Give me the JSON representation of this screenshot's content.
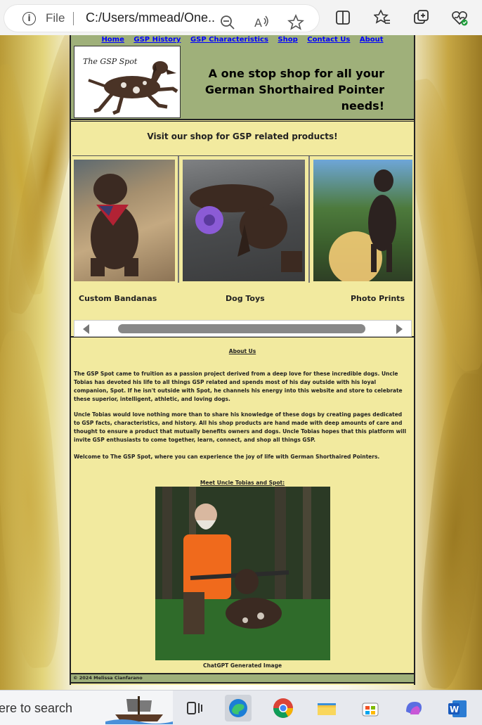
{
  "browser": {
    "site_info_label": "File",
    "url": "C:/Users/mmead/One...",
    "icons": [
      "info-icon",
      "zoom-out-icon",
      "read-aloud-icon",
      "favorite-star-icon",
      "split-screen-icon",
      "favorites-icon",
      "collections-icon",
      "browser-essentials-icon"
    ]
  },
  "nav": {
    "items": [
      "Home",
      "GSP History",
      "GSP Characteristics",
      "Shop",
      "Contact Us",
      "About"
    ]
  },
  "header": {
    "logo_text": "The GSP Spot",
    "tagline_line1": "A one stop shop for all your",
    "tagline_line2": "German Shorthaired Pointer needs!"
  },
  "shop": {
    "title": "Visit our shop for GSP related products!",
    "products": [
      {
        "label": "Custom Bandanas"
      },
      {
        "label": "Dog Toys"
      },
      {
        "label": "Photo Prints"
      }
    ]
  },
  "about": {
    "title": "About Us",
    "paragraphs": [
      "The GSP Spot came to fruition as a passion project derived from a deep love for these incredible dogs. Uncle Tobias has devoted his life to all things GSP related and spends most of his day outside with his loyal companion, Spot. If he isn't outside with Spot, he channels his energy into this website and store to celebrate these superior, intelligent, athletic, and loving dogs.",
      "Uncle Tobias would love nothing more than to share his knowledge of these dogs by creating pages dedicated to GSP facts, characteristics, and history. All his shop products are hand made with deep amounts of care and thought to ensure a product that mutually benefits owners and dogs. Uncle Tobias hopes that this platform will invite GSP enthusiasts to come together, learn, connect, and shop all things GSP.",
      "Welcome to The GSP Spot, where you can experience the joy of life with German Shorthaired Pointers."
    ],
    "meet_heading": "Meet Uncle Tobias and Spot:",
    "image_caption": "ChatGPT Generated Image"
  },
  "footer": {
    "copyright": "© 2024 Melissa Cianfarano"
  },
  "taskbar": {
    "search_text": "ere to search",
    "apps": [
      "task-view-icon",
      "edge-icon",
      "chrome-icon",
      "file-explorer-icon",
      "microsoft-store-icon",
      "copilot-icon",
      "word-icon"
    ]
  },
  "colors": {
    "header_bg": "#9fb07a",
    "page_bg": "#f2ea9f",
    "nav_link": "#0000ff"
  }
}
